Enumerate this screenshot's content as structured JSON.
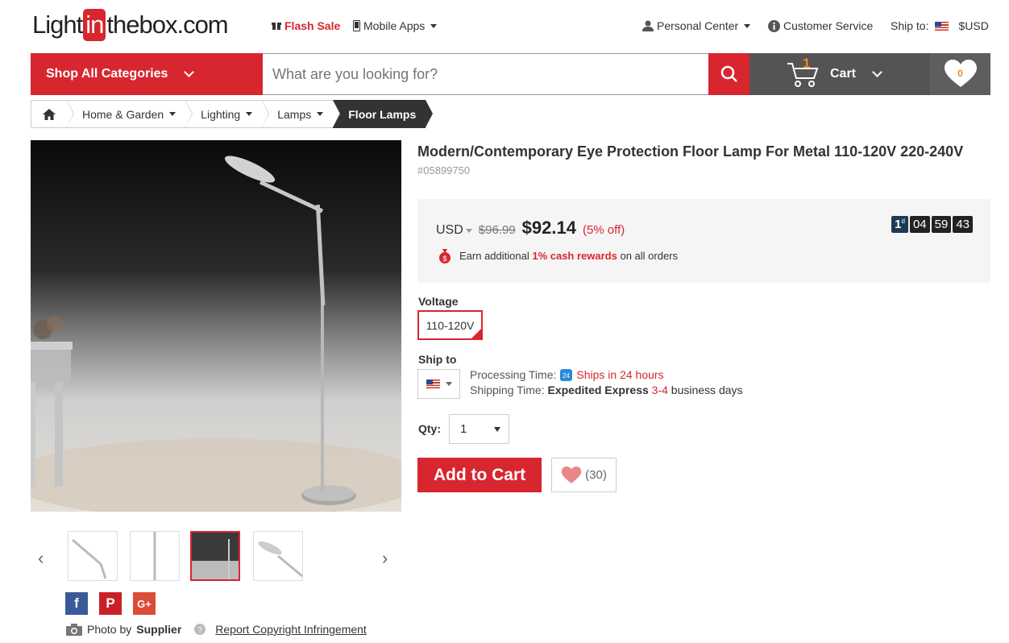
{
  "header": {
    "logo": {
      "part1": "Light",
      "part2": "in",
      "part3": "thebox",
      "part4": ".com"
    },
    "flash_sale": "Flash Sale",
    "mobile_apps": "Mobile Apps",
    "personal_center": "Personal Center",
    "customer_service": "Customer Service",
    "ship_to_label": "Ship to:",
    "currency": "$USD"
  },
  "nav": {
    "shop_all": "Shop All Categories",
    "search_placeholder": "What are you looking for?",
    "cart_label": "Cart",
    "cart_count": "1",
    "wishlist_count": "0"
  },
  "breadcrumb": [
    {
      "label": "Home & Garden"
    },
    {
      "label": "Lighting"
    },
    {
      "label": "Lamps"
    },
    {
      "label": "Floor Lamps"
    }
  ],
  "product": {
    "title": "Modern/Contemporary Eye Protection Floor Lamp For Metal 110-120V 220-240V",
    "sku": "#05899750",
    "currency": "USD",
    "old_price": "$96.99",
    "price": "$92.14",
    "discount": "(5% off)",
    "cash_pre": "Earn additional ",
    "cash_highlight": "1% cash rewards",
    "cash_post": " on all orders",
    "timer": {
      "days": "1",
      "days_unit": "d",
      "hours": "04",
      "minutes": "59",
      "seconds": "43"
    },
    "voltage_label": "Voltage",
    "voltage_value": "110-120V",
    "ship_to_label": "Ship to",
    "processing_label": "Processing Time:",
    "processing_value": "Ships in 24 hours",
    "shipping_label": "Shipping Time:",
    "shipping_method": "Expedited Express",
    "shipping_days": "3-4",
    "shipping_suffix": "business days",
    "qty_label": "Qty:",
    "qty_value": "1",
    "add_to_cart": "Add to Cart",
    "likes": "(30)"
  },
  "footer": {
    "photo_by": "Photo by",
    "supplier": "Supplier",
    "report": "Report Copyright Infringement"
  },
  "colors": {
    "brand_red": "#d8262f",
    "dark_bar": "#545454"
  }
}
